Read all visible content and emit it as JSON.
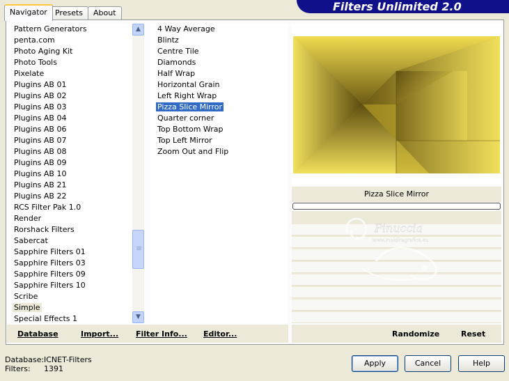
{
  "tabs": [
    {
      "label": "Navigator",
      "active": true
    },
    {
      "label": "Presets",
      "active": false
    },
    {
      "label": "About",
      "active": false
    }
  ],
  "banner": "Filters Unlimited 2.0",
  "categories": [
    "Pattern Generators",
    "penta.com",
    "Photo Aging Kit",
    "Photo Tools",
    "Pixelate",
    "Plugins AB 01",
    "Plugins AB 02",
    "Plugins AB 03",
    "Plugins AB 04",
    "Plugins AB 06",
    "Plugins AB 07",
    "Plugins AB 08",
    "Plugins AB 09",
    "Plugins AB 10",
    "Plugins AB 21",
    "Plugins AB 22",
    "RCS Filter Pak 1.0",
    "Render",
    "Rorshack Filters",
    "Sabercat",
    "Sapphire Filters 01",
    "Sapphire Filters 03",
    "Sapphire Filters 09",
    "Sapphire Filters 10",
    "Scribe",
    "Simple",
    "Special Effects 1"
  ],
  "selected_category": "Simple",
  "filters": [
    "4 Way Average",
    "Blintz",
    "Centre Tile",
    "Diamonds",
    "Half Wrap",
    "Horizontal Grain",
    "Left Right Wrap",
    "Pizza Slice Mirror",
    "Quarter corner",
    "Top Bottom Wrap",
    "Top Left Mirror",
    "Zoom Out and Flip"
  ],
  "selected_filter": "Pizza Slice Mirror",
  "links": {
    "database": "Database",
    "import": "Import...",
    "filter_info": "Filter Info...",
    "editor": "Editor...",
    "randomize": "Randomize",
    "reset": "Reset"
  },
  "preview_title": "Pizza Slice Mirror",
  "watermark": {
    "name": "Pinuccia",
    "site": "www.maidiragrafica.eu"
  },
  "status": {
    "database_label": "Database:",
    "database_value": "ICNET-Filters",
    "filters_label": "Filters:",
    "filters_value": "1391"
  },
  "buttons": {
    "apply": "Apply",
    "cancel": "Cancel",
    "help": "Help"
  },
  "colors": {
    "banner": "#10108a",
    "selection": "#316ac5",
    "preview_light": "#f0dc52",
    "preview_dark": "#5a4a0e"
  }
}
